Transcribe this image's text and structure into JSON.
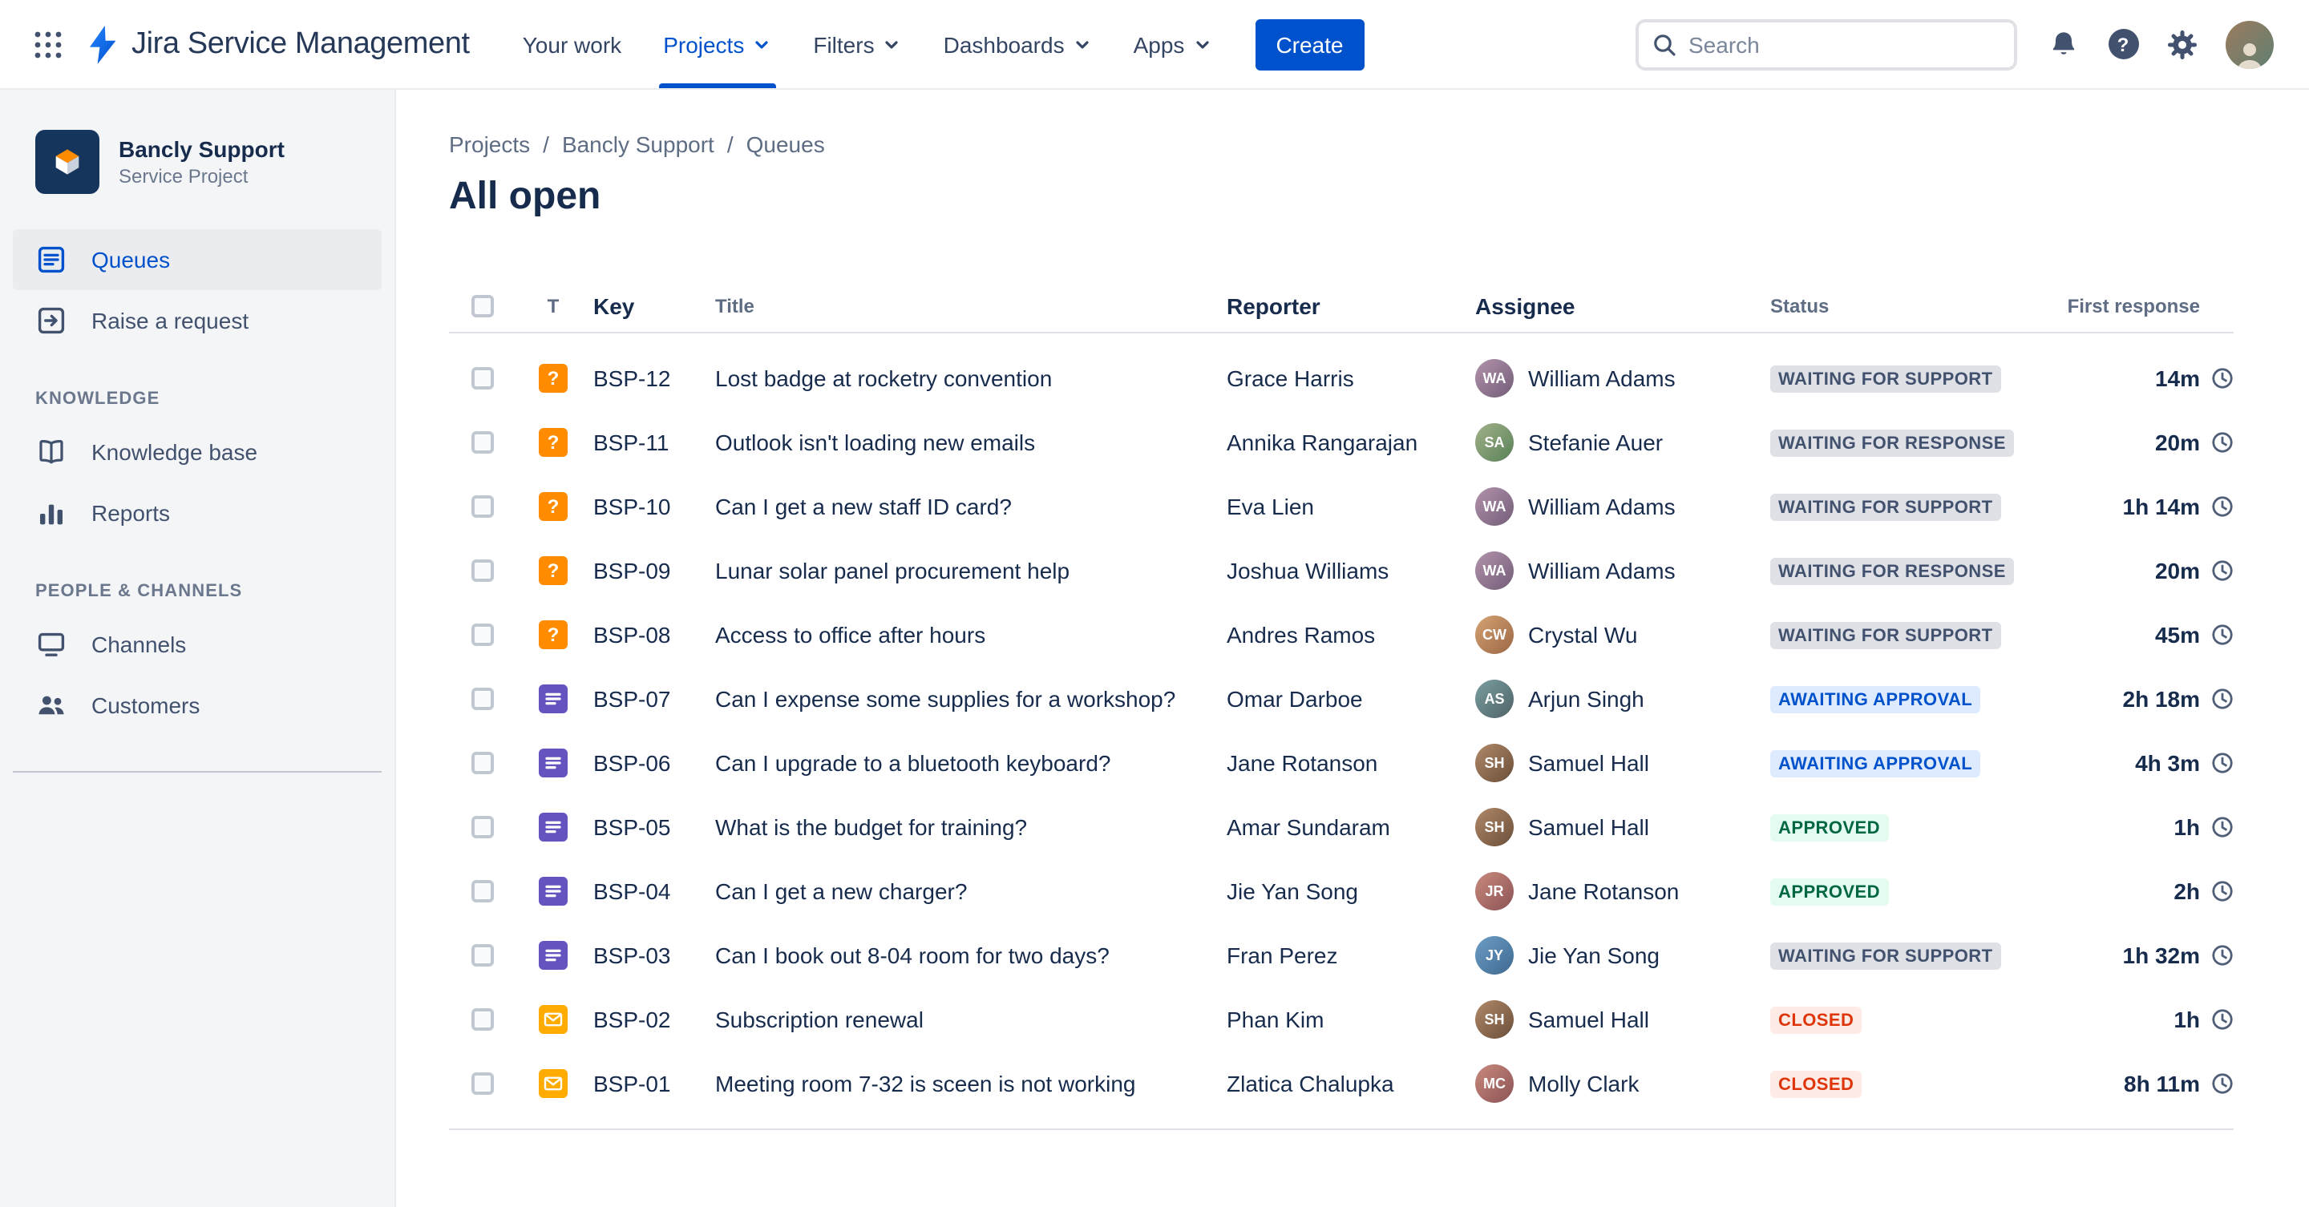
{
  "topbar": {
    "product_name": "Jira Service Management",
    "nav": [
      {
        "label": "Your work",
        "has_dropdown": false,
        "active": false
      },
      {
        "label": "Projects",
        "has_dropdown": true,
        "active": true
      },
      {
        "label": "Filters",
        "has_dropdown": true,
        "active": false
      },
      {
        "label": "Dashboards",
        "has_dropdown": true,
        "active": false
      },
      {
        "label": "Apps",
        "has_dropdown": true,
        "active": false
      }
    ],
    "create_label": "Create",
    "search_placeholder": "Search"
  },
  "sidebar": {
    "project_name": "Bancly Support",
    "project_type": "Service Project",
    "items_top": [
      {
        "label": "Queues",
        "active": true
      },
      {
        "label": "Raise a request",
        "active": false
      }
    ],
    "sections": [
      {
        "title": "KNOWLEDGE",
        "items": [
          {
            "label": "Knowledge base"
          },
          {
            "label": "Reports"
          }
        ]
      },
      {
        "title": "PEOPLE & CHANNELS",
        "items": [
          {
            "label": "Channels"
          },
          {
            "label": "Customers"
          }
        ]
      }
    ]
  },
  "breadcrumb": [
    "Projects",
    "Bancly Support",
    "Queues"
  ],
  "breadcrumb_separator": "/",
  "page_title": "All open",
  "table": {
    "headers": {
      "type": "T",
      "key": "Key",
      "title": "Title",
      "reporter": "Reporter",
      "assignee": "Assignee",
      "status": "Status",
      "first_response": "First response"
    },
    "rows": [
      {
        "type": "question",
        "key": "BSP-12",
        "title": "Lost badge at rocketry convention",
        "reporter": "Grace Harris",
        "assignee": "William Adams",
        "status": "WAITING FOR SUPPORT",
        "status_type": "gray",
        "first_response": "14m"
      },
      {
        "type": "question",
        "key": "BSP-11",
        "title": "Outlook isn't loading new emails",
        "reporter": "Annika Rangarajan",
        "assignee": "Stefanie Auer",
        "status": "WAITING FOR RESPONSE",
        "status_type": "gray",
        "first_response": "20m"
      },
      {
        "type": "question",
        "key": "BSP-10",
        "title": "Can I get a new staff ID card?",
        "reporter": "Eva Lien",
        "assignee": "William Adams",
        "status": "WAITING FOR SUPPORT",
        "status_type": "gray",
        "first_response": "1h 14m"
      },
      {
        "type": "question",
        "key": "BSP-09",
        "title": "Lunar solar panel procurement help",
        "reporter": "Joshua Williams",
        "assignee": "William Adams",
        "status": "WAITING FOR RESPONSE",
        "status_type": "gray",
        "first_response": "20m"
      },
      {
        "type": "question",
        "key": "BSP-08",
        "title": "Access to office after hours",
        "reporter": "Andres Ramos",
        "assignee": "Crystal Wu",
        "status": "WAITING FOR SUPPORT",
        "status_type": "gray",
        "first_response": "45m"
      },
      {
        "type": "form",
        "key": "BSP-07",
        "title": "Can I expense some supplies for a workshop?",
        "reporter": "Omar Darboe",
        "assignee": "Arjun Singh",
        "status": "AWAITING APPROVAL",
        "status_type": "blue",
        "first_response": "2h 18m"
      },
      {
        "type": "form",
        "key": "BSP-06",
        "title": "Can I upgrade to a bluetooth keyboard?",
        "reporter": "Jane Rotanson",
        "assignee": "Samuel Hall",
        "status": "AWAITING APPROVAL",
        "status_type": "blue",
        "first_response": "4h 3m"
      },
      {
        "type": "form",
        "key": "BSP-05",
        "title": "What is the budget for training?",
        "reporter": "Amar Sundaram",
        "assignee": "Samuel Hall",
        "status": "APPROVED",
        "status_type": "green",
        "first_response": "1h"
      },
      {
        "type": "form",
        "key": "BSP-04",
        "title": "Can I get a new charger?",
        "reporter": "Jie Yan Song",
        "assignee": "Jane Rotanson",
        "status": "APPROVED",
        "status_type": "green",
        "first_response": "2h"
      },
      {
        "type": "form",
        "key": "BSP-03",
        "title": "Can I book out 8-04 room for two days?",
        "reporter": "Fran Perez",
        "assignee": "Jie Yan Song",
        "status": "WAITING FOR SUPPORT",
        "status_type": "gray",
        "first_response": "1h 32m"
      },
      {
        "type": "email",
        "key": "BSP-02",
        "title": "Subscription renewal",
        "reporter": "Phan Kim",
        "assignee": "Samuel Hall",
        "status": "CLOSED",
        "status_type": "red",
        "first_response": "1h"
      },
      {
        "type": "email",
        "key": "BSP-01",
        "title": "Meeting room 7-32 is sceen is not working",
        "reporter": "Zlatica Chalupka",
        "assignee": "Molly Clark",
        "status": "CLOSED",
        "status_type": "red",
        "first_response": "8h 11m"
      }
    ]
  },
  "icons": {
    "app-switcher": "grid-dots",
    "notifications": "bell",
    "help": "question-circle",
    "settings": "gear",
    "search": "magnifier",
    "first-response": "clock",
    "type-question": "question-mark-tile",
    "type-form": "document-tile",
    "type-email": "envelope-tile"
  },
  "colors": {
    "brand_blue": "#0052CC",
    "status_gray_bg": "#DFE1E6",
    "status_gray_text": "#42526E",
    "status_blue_bg": "#DEEBFF",
    "status_blue_text": "#0052CC",
    "status_green_bg": "#E3FCEF",
    "status_green_text": "#006644",
    "status_red_bg": "#FFEBE6",
    "status_red_text": "#DE350B",
    "type_question": "#FF8B00",
    "type_form": "#6554C0",
    "type_email": "#FFAB00"
  }
}
